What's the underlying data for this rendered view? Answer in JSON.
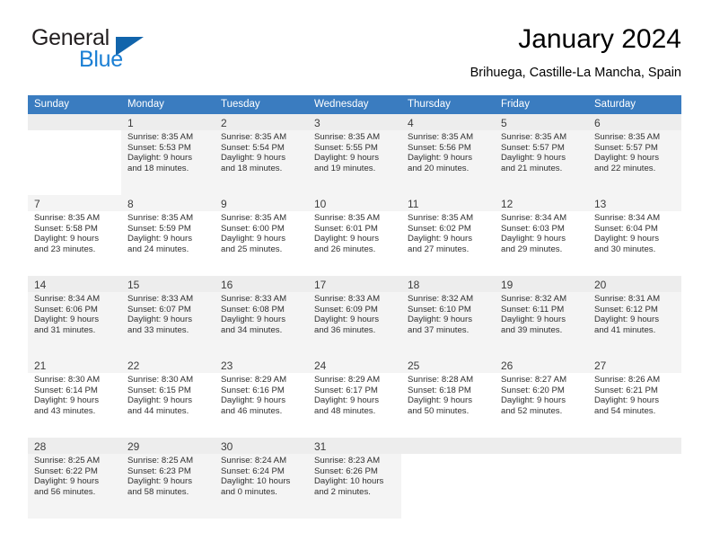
{
  "brand": {
    "name_part1": "General",
    "name_part2": "Blue",
    "logo_icon": "triangle-logo-icon"
  },
  "header": {
    "title": "January 2024",
    "subtitle": "Brihuega, Castille-La Mancha, Spain"
  },
  "calendar": {
    "accent_color": "#3a7cc0",
    "weekday_headers": [
      "Sunday",
      "Monday",
      "Tuesday",
      "Wednesday",
      "Thursday",
      "Friday",
      "Saturday"
    ],
    "weeks": [
      [
        {
          "day": "",
          "lines": []
        },
        {
          "day": "1",
          "lines": [
            "Sunrise: 8:35 AM",
            "Sunset: 5:53 PM",
            "Daylight: 9 hours",
            "and 18 minutes."
          ]
        },
        {
          "day": "2",
          "lines": [
            "Sunrise: 8:35 AM",
            "Sunset: 5:54 PM",
            "Daylight: 9 hours",
            "and 18 minutes."
          ]
        },
        {
          "day": "3",
          "lines": [
            "Sunrise: 8:35 AM",
            "Sunset: 5:55 PM",
            "Daylight: 9 hours",
            "and 19 minutes."
          ]
        },
        {
          "day": "4",
          "lines": [
            "Sunrise: 8:35 AM",
            "Sunset: 5:56 PM",
            "Daylight: 9 hours",
            "and 20 minutes."
          ]
        },
        {
          "day": "5",
          "lines": [
            "Sunrise: 8:35 AM",
            "Sunset: 5:57 PM",
            "Daylight: 9 hours",
            "and 21 minutes."
          ]
        },
        {
          "day": "6",
          "lines": [
            "Sunrise: 8:35 AM",
            "Sunset: 5:57 PM",
            "Daylight: 9 hours",
            "and 22 minutes."
          ]
        }
      ],
      [
        {
          "day": "7",
          "lines": [
            "Sunrise: 8:35 AM",
            "Sunset: 5:58 PM",
            "Daylight: 9 hours",
            "and 23 minutes."
          ]
        },
        {
          "day": "8",
          "lines": [
            "Sunrise: 8:35 AM",
            "Sunset: 5:59 PM",
            "Daylight: 9 hours",
            "and 24 minutes."
          ]
        },
        {
          "day": "9",
          "lines": [
            "Sunrise: 8:35 AM",
            "Sunset: 6:00 PM",
            "Daylight: 9 hours",
            "and 25 minutes."
          ]
        },
        {
          "day": "10",
          "lines": [
            "Sunrise: 8:35 AM",
            "Sunset: 6:01 PM",
            "Daylight: 9 hours",
            "and 26 minutes."
          ]
        },
        {
          "day": "11",
          "lines": [
            "Sunrise: 8:35 AM",
            "Sunset: 6:02 PM",
            "Daylight: 9 hours",
            "and 27 minutes."
          ]
        },
        {
          "day": "12",
          "lines": [
            "Sunrise: 8:34 AM",
            "Sunset: 6:03 PM",
            "Daylight: 9 hours",
            "and 29 minutes."
          ]
        },
        {
          "day": "13",
          "lines": [
            "Sunrise: 8:34 AM",
            "Sunset: 6:04 PM",
            "Daylight: 9 hours",
            "and 30 minutes."
          ]
        }
      ],
      [
        {
          "day": "14",
          "lines": [
            "Sunrise: 8:34 AM",
            "Sunset: 6:06 PM",
            "Daylight: 9 hours",
            "and 31 minutes."
          ]
        },
        {
          "day": "15",
          "lines": [
            "Sunrise: 8:33 AM",
            "Sunset: 6:07 PM",
            "Daylight: 9 hours",
            "and 33 minutes."
          ]
        },
        {
          "day": "16",
          "lines": [
            "Sunrise: 8:33 AM",
            "Sunset: 6:08 PM",
            "Daylight: 9 hours",
            "and 34 minutes."
          ]
        },
        {
          "day": "17",
          "lines": [
            "Sunrise: 8:33 AM",
            "Sunset: 6:09 PM",
            "Daylight: 9 hours",
            "and 36 minutes."
          ]
        },
        {
          "day": "18",
          "lines": [
            "Sunrise: 8:32 AM",
            "Sunset: 6:10 PM",
            "Daylight: 9 hours",
            "and 37 minutes."
          ]
        },
        {
          "day": "19",
          "lines": [
            "Sunrise: 8:32 AM",
            "Sunset: 6:11 PM",
            "Daylight: 9 hours",
            "and 39 minutes."
          ]
        },
        {
          "day": "20",
          "lines": [
            "Sunrise: 8:31 AM",
            "Sunset: 6:12 PM",
            "Daylight: 9 hours",
            "and 41 minutes."
          ]
        }
      ],
      [
        {
          "day": "21",
          "lines": [
            "Sunrise: 8:30 AM",
            "Sunset: 6:14 PM",
            "Daylight: 9 hours",
            "and 43 minutes."
          ]
        },
        {
          "day": "22",
          "lines": [
            "Sunrise: 8:30 AM",
            "Sunset: 6:15 PM",
            "Daylight: 9 hours",
            "and 44 minutes."
          ]
        },
        {
          "day": "23",
          "lines": [
            "Sunrise: 8:29 AM",
            "Sunset: 6:16 PM",
            "Daylight: 9 hours",
            "and 46 minutes."
          ]
        },
        {
          "day": "24",
          "lines": [
            "Sunrise: 8:29 AM",
            "Sunset: 6:17 PM",
            "Daylight: 9 hours",
            "and 48 minutes."
          ]
        },
        {
          "day": "25",
          "lines": [
            "Sunrise: 8:28 AM",
            "Sunset: 6:18 PM",
            "Daylight: 9 hours",
            "and 50 minutes."
          ]
        },
        {
          "day": "26",
          "lines": [
            "Sunrise: 8:27 AM",
            "Sunset: 6:20 PM",
            "Daylight: 9 hours",
            "and 52 minutes."
          ]
        },
        {
          "day": "27",
          "lines": [
            "Sunrise: 8:26 AM",
            "Sunset: 6:21 PM",
            "Daylight: 9 hours",
            "and 54 minutes."
          ]
        }
      ],
      [
        {
          "day": "28",
          "lines": [
            "Sunrise: 8:25 AM",
            "Sunset: 6:22 PM",
            "Daylight: 9 hours",
            "and 56 minutes."
          ]
        },
        {
          "day": "29",
          "lines": [
            "Sunrise: 8:25 AM",
            "Sunset: 6:23 PM",
            "Daylight: 9 hours",
            "and 58 minutes."
          ]
        },
        {
          "day": "30",
          "lines": [
            "Sunrise: 8:24 AM",
            "Sunset: 6:24 PM",
            "Daylight: 10 hours",
            "and 0 minutes."
          ]
        },
        {
          "day": "31",
          "lines": [
            "Sunrise: 8:23 AM",
            "Sunset: 6:26 PM",
            "Daylight: 10 hours",
            "and 2 minutes."
          ]
        },
        {
          "day": "",
          "lines": []
        },
        {
          "day": "",
          "lines": []
        },
        {
          "day": "",
          "lines": []
        }
      ]
    ]
  }
}
